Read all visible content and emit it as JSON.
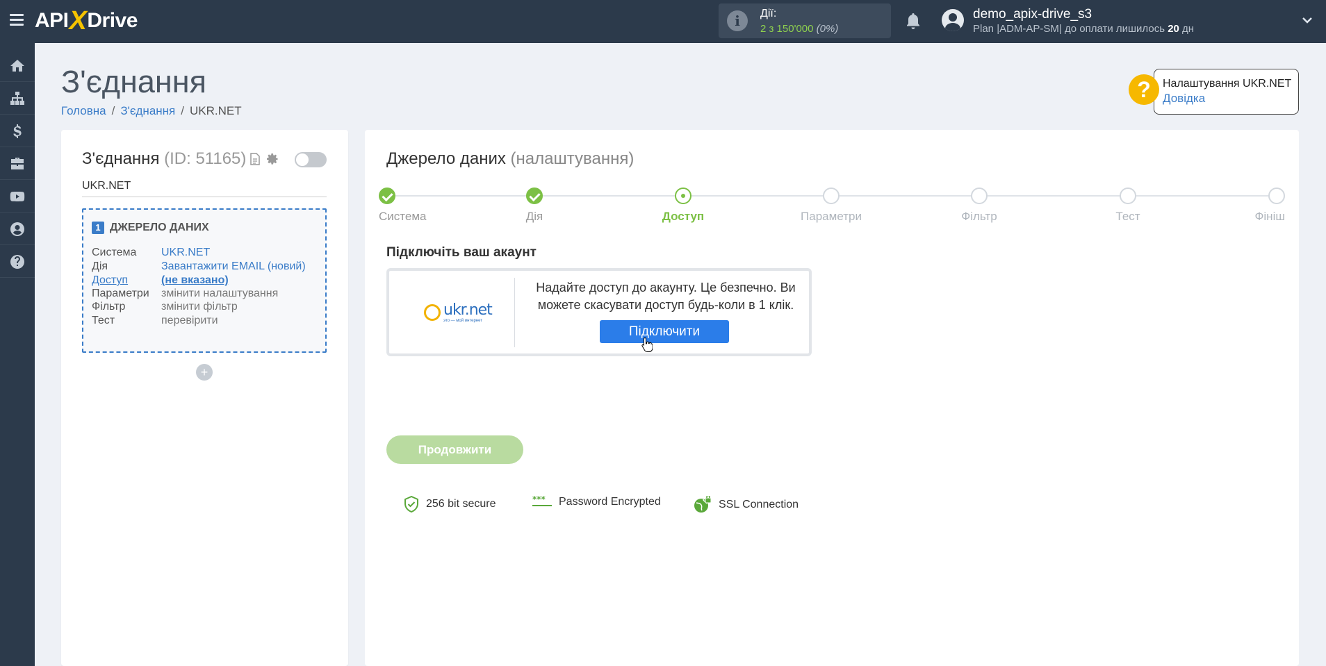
{
  "topbar": {
    "logo_left": "API",
    "logo_x": "X",
    "logo_right": "Drive",
    "actions_title": "Дії:",
    "actions_count": "2 з 150'000",
    "actions_percent": "(0%)",
    "user_name": "demo_apix-drive_s3",
    "plan_text": "Plan |ADM-AP-SM| до оплати лишилось",
    "plan_days": "20",
    "plan_days_unit": "дн"
  },
  "sidebar": {
    "items": [
      "home-icon",
      "sitemap-icon",
      "dollar-icon",
      "briefcase-icon",
      "youtube-icon",
      "user-icon",
      "help-icon"
    ]
  },
  "page": {
    "title": "З'єднання",
    "breadcrumb": [
      "Головна",
      "З'єднання",
      "UKR.NET"
    ]
  },
  "help": {
    "title": "Налаштування UKR.NET",
    "link": "Довідка",
    "q": "?"
  },
  "connection": {
    "title": "З'єднання",
    "id_text": "(ID: 51165)",
    "name": "UKR.NET",
    "source_num": "1",
    "source_title": "ДЖЕРЕЛО ДАНИХ",
    "rows": [
      {
        "k": "Система",
        "v": "UKR.NET"
      },
      {
        "k": "Дія",
        "v": "Завантажити EMAIL (новий)"
      },
      {
        "k": "Доступ",
        "v": "(не вказано)"
      },
      {
        "k": "Параметри",
        "v": "змінити налаштування"
      },
      {
        "k": "Фільтр",
        "v": "змінити фільтр"
      },
      {
        "k": "Тест",
        "v": "перевірити"
      }
    ],
    "add": "+"
  },
  "main": {
    "title": "Джерело даних",
    "title_sub": "(налаштування)",
    "steps": [
      "Система",
      "Дія",
      "Доступ",
      "Параметри",
      "Фільтр",
      "Тест",
      "Фініш"
    ],
    "connect_title": "Підключіть ваш акаунт",
    "auth_text": "Надайте доступ до акаунту. Це безпечно. Ви можете скасувати доступ будь-коли в 1 клік.",
    "connect_button": "Підключити",
    "logo_text": "ukr.net",
    "logo_sub": "это — мой интернет",
    "security": [
      "256 bit secure",
      "Password Encrypted",
      "SSL Connection"
    ],
    "continue_button": "Продовжити"
  },
  "colors": {
    "topbar": "#2c3a4b",
    "accent_green": "#7cc045",
    "link_blue": "#3a7cc8",
    "button_blue": "#2b7de9"
  }
}
